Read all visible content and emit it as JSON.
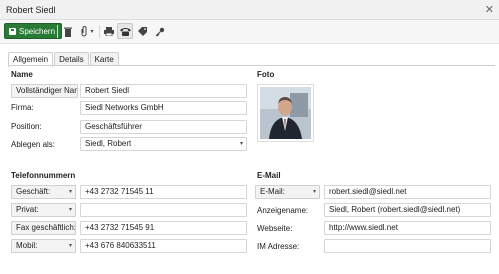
{
  "window": {
    "title": "Robert Siedl",
    "close_icon": "close-icon"
  },
  "toolbar": {
    "save_label": "Speichern",
    "icons": [
      "save-icon",
      "trash-icon",
      "paperclip-icon",
      "chevron-down-icon",
      "print-icon",
      "phone-icon",
      "tag-icon",
      "key-icon"
    ]
  },
  "tabs": [
    {
      "label": "Allgemein",
      "active": true
    },
    {
      "label": "Details",
      "active": false
    },
    {
      "label": "Karte",
      "active": false
    }
  ],
  "name_section": {
    "title": "Name",
    "full_name_select": "Vollständiger Name",
    "full_name_value": "Robert Siedl",
    "company_label": "Firma:",
    "company_value": "Siedl Networks GmbH",
    "position_label": "Position:",
    "position_value": "Geschäftsführer",
    "file_as_label": "Ablegen als:",
    "file_as_value": "Siedl, Robert"
  },
  "photo_section": {
    "title": "Foto"
  },
  "phone_section": {
    "title": "Telefonnummern",
    "rows": [
      {
        "type": "Geschäft:",
        "value": "+43 2732 71545 11"
      },
      {
        "type": "Privat:",
        "value": ""
      },
      {
        "type": "Fax geschäftlich:",
        "value": "+43 2732 71545 91"
      },
      {
        "type": "Mobil:",
        "value": "+43 676 840633511"
      }
    ]
  },
  "email_section": {
    "title": "E-Mail",
    "email_select": "E-Mail:",
    "email_value": "robert.siedl@siedl.net",
    "display_name_label": "Anzeigename:",
    "display_name_value": "Siedl, Robert (robert.siedl@siedl.net)",
    "website_label": "Webseite:",
    "website_value": "http://www.siedl.net",
    "im_label": "IM Adresse:",
    "im_value": ""
  },
  "colors": {
    "save_button": "#287a36",
    "border": "#d6d6d6"
  }
}
